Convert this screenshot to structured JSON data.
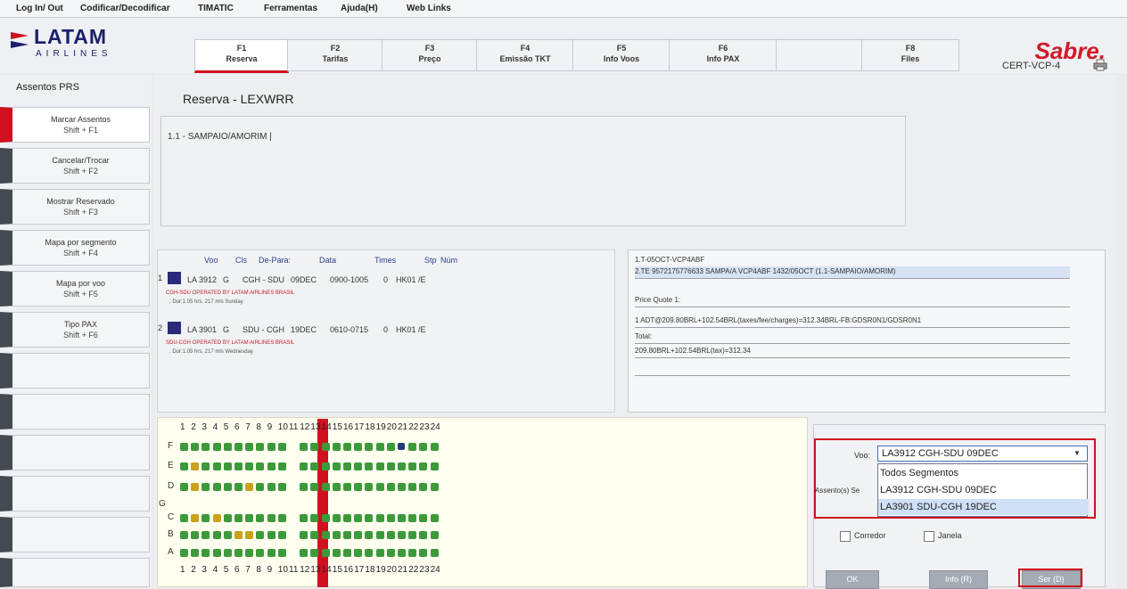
{
  "menu": [
    "Log In/ Out",
    "Codificar/Decodificar",
    "TIMATIC",
    "Ferramentas",
    "Ajuda(H)",
    "Web Links"
  ],
  "logo": {
    "latam": "LATAM",
    "airlines": "AIRLINES"
  },
  "fkeys": [
    {
      "key": "F1",
      "name": "Reserva"
    },
    {
      "key": "F2",
      "name": "Tarifas"
    },
    {
      "key": "F3",
      "name": "Preço"
    },
    {
      "key": "F4",
      "name": "Emissão TKT"
    },
    {
      "key": "F5",
      "name": "Info Voos"
    },
    {
      "key": "F6",
      "name": "Info PAX"
    },
    {
      "key": "",
      "name": ""
    },
    {
      "key": "F8",
      "name": "Files"
    }
  ],
  "sabre": {
    "logo": "Sabre.",
    "env": "CERT-VCP-4"
  },
  "sidebar": {
    "title": "Assentos PRS",
    "items": [
      {
        "label": "Marcar Assentos",
        "shortcut": "Shift + F1"
      },
      {
        "label": "Cancelar/Trocar",
        "shortcut": "Shift + F2"
      },
      {
        "label": "Mostrar Reservado",
        "shortcut": "Shift + F3"
      },
      {
        "label": "Mapa por segmento",
        "shortcut": "Shift + F4"
      },
      {
        "label": "Mapa por voo",
        "shortcut": "Shift + F5"
      },
      {
        "label": "Tipo PAX",
        "shortcut": "Shift + F6"
      }
    ]
  },
  "reserva": {
    "title": "Reserva - LEXWRR",
    "pnr_line": "1.1 -  SAMPAIO/AMORIM  |"
  },
  "segments": {
    "headers": [
      "Voo",
      "Cls",
      "De-Para:",
      "Data",
      "Times",
      "Stp",
      "Núm"
    ],
    "rows": [
      {
        "num": "1",
        "voo": "LA 3912",
        "cls": "G",
        "route": "CGH - SDU",
        "date": "09DEC",
        "times": "0900-1005",
        "stp": "0",
        "status": "HK01 /E",
        "operated": "CGH-SDU OPERATED BY LATAM AIRLINES BRASIL",
        "duration": ", Dur:1.05 hrs, 217 mls Sunday"
      },
      {
        "num": "2",
        "voo": "LA 3901",
        "cls": "G",
        "route": "SDU - CGH",
        "date": "19DEC",
        "times": "0610-0715",
        "stp": "0",
        "status": "HK01 /E",
        "operated": "SDU-CGH OPERATED BY LATAM AIRLINES BRASIL",
        "duration": ", Dur:1.05 hrs, 217 mls Wednesday"
      }
    ]
  },
  "price_quote": {
    "line1": "1.T-05OCT-VCP4ABF",
    "line2": "2.TE 9572175776633 SAMPA/A VCP4ABF 1432/05OCT (1.1-SAMPAIO/AMORIM)",
    "pq_label": "Price Quote 1:",
    "pq_line": "1 ADT@209.80BRL+102.54BRL(taxes/fee/charges)=312.34BRL-FB:GDSR0N1/GDSR0N1",
    "total_label": "Total:",
    "total_line": "209.80BRL+102.54BRL(tax)=312.34"
  },
  "seatmap": {
    "columns": [
      "1",
      "2",
      "3",
      "4",
      "5",
      "6",
      "7",
      "8",
      "9",
      "10",
      "11",
      "12",
      "13",
      "14",
      "15",
      "16",
      "17",
      "18",
      "19",
      "20",
      "21",
      "22",
      "23",
      "24"
    ],
    "rows": [
      "F",
      "E",
      "D",
      "G",
      "C",
      "B",
      "A"
    ]
  },
  "right_panel": {
    "voo_label": "Voo:",
    "voo_selected": "LA3912 CGH-SDU 09DEC",
    "voo_options": [
      "Todos Segmentos",
      "LA3912 CGH-SDU 09DEC",
      "LA3901 SDU-CGH 19DEC"
    ],
    "assentos_label": "Assento(s) Se",
    "corredor": "Corredor",
    "janela": "Janela",
    "btn_ok": "OK",
    "btn_info": "Info (R)",
    "btn_ser": "Ser (D)"
  },
  "colors": {
    "accent": "#d0101f",
    "brand": "#1a1f6b",
    "seat": "#3d9a3a"
  }
}
